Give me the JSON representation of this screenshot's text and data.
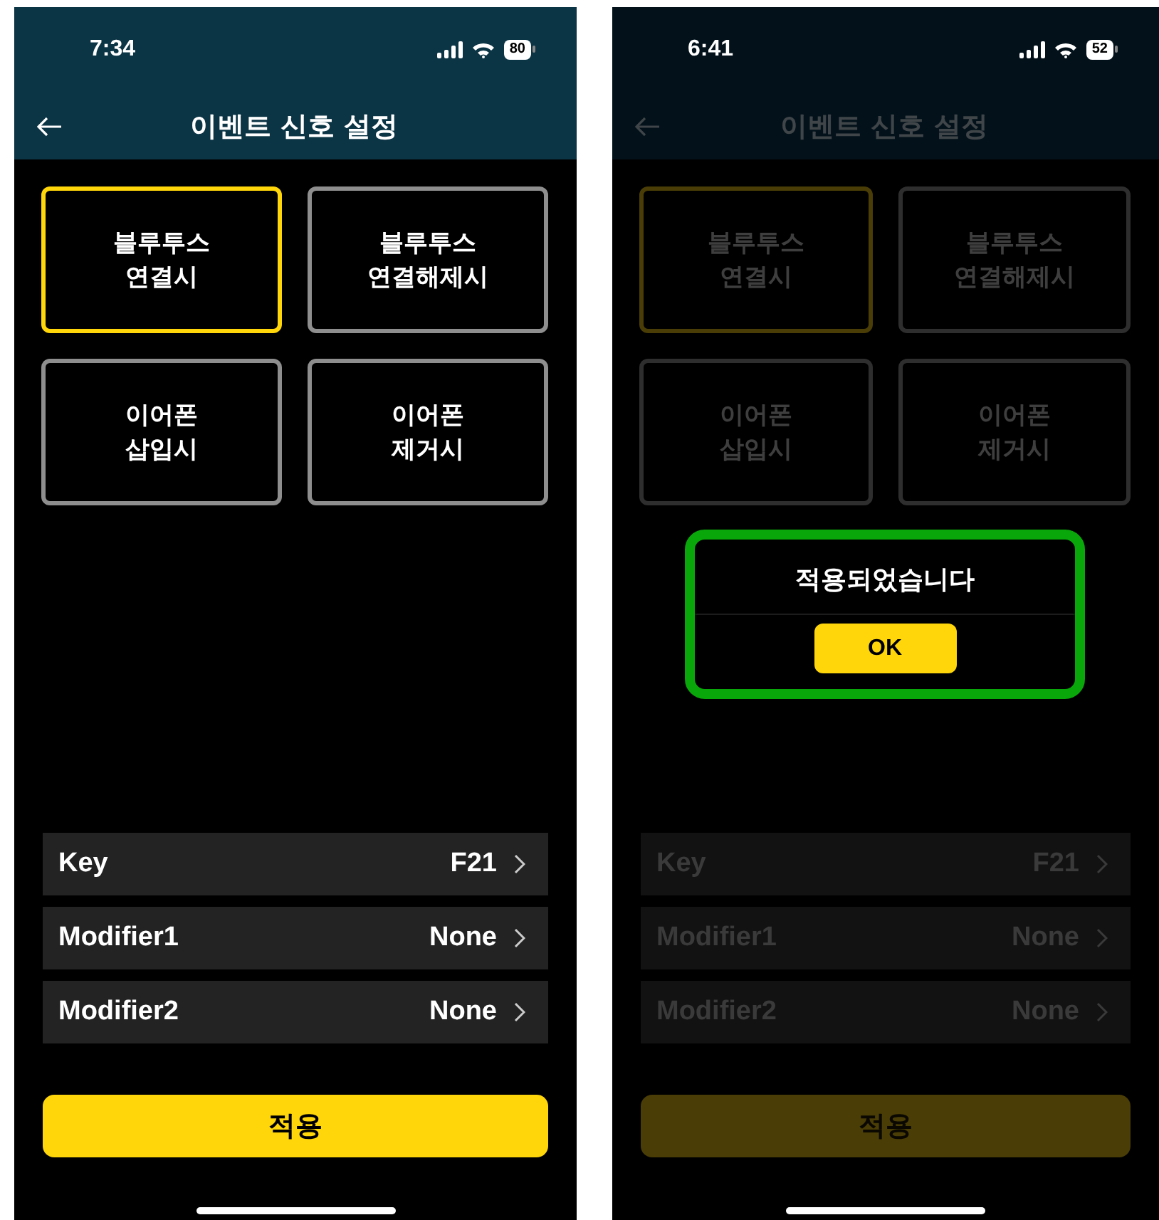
{
  "screens": [
    {
      "dimmed": false,
      "status_bar": {
        "time": "7:34",
        "battery": "80"
      },
      "header": {
        "title": "이벤트 신호 설정"
      },
      "events": [
        {
          "label": "블루투스\n연결시",
          "selected": true
        },
        {
          "label": "블루투스\n연결해제시",
          "selected": false
        },
        {
          "label": "이어폰\n삽입시",
          "selected": false
        },
        {
          "label": "이어폰\n제거시",
          "selected": false
        }
      ],
      "settings": [
        {
          "label": "Key",
          "value": "F21"
        },
        {
          "label": "Modifier1",
          "value": "None"
        },
        {
          "label": "Modifier2",
          "value": "None"
        }
      ],
      "apply_button": "적용"
    },
    {
      "dimmed": true,
      "status_bar": {
        "time": "6:41",
        "battery": "52"
      },
      "header": {
        "title": "이벤트 신호 설정"
      },
      "events": [
        {
          "label": "블루투스\n연결시",
          "selected": true
        },
        {
          "label": "블루투스\n연결해제시",
          "selected": false
        },
        {
          "label": "이어폰\n삽입시",
          "selected": false
        },
        {
          "label": "이어폰\n제거시",
          "selected": false
        }
      ],
      "dialog": {
        "message": "적용되었습니다",
        "button": "OK"
      },
      "settings": [
        {
          "label": "Key",
          "value": "F21"
        },
        {
          "label": "Modifier1",
          "value": "None"
        },
        {
          "label": "Modifier2",
          "value": "None"
        }
      ],
      "apply_button": "적용"
    }
  ]
}
